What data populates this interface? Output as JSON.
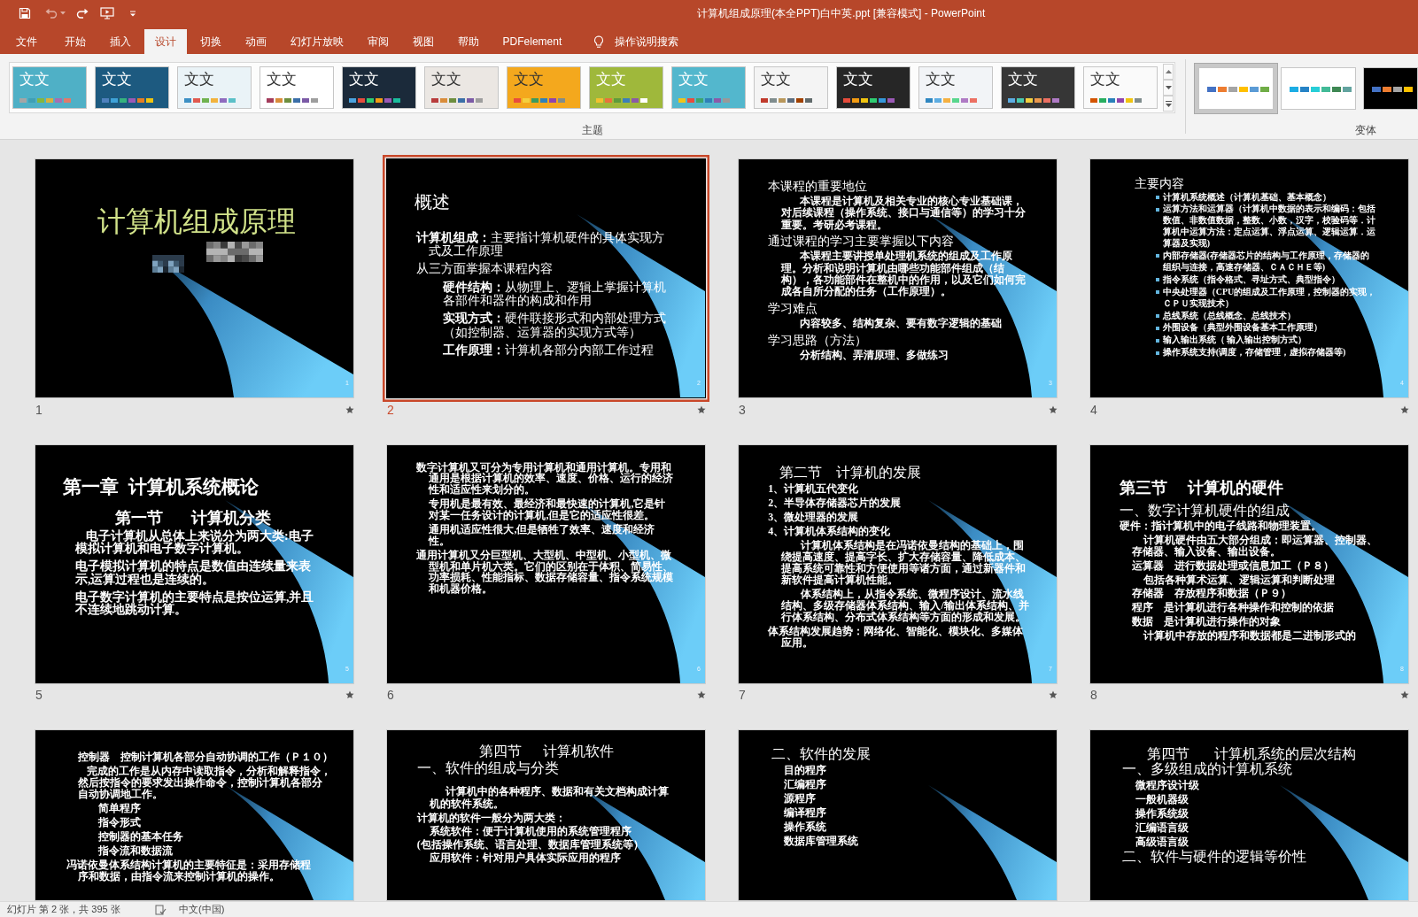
{
  "window": {
    "title": "计算机组成原理(本全PPT)白中英.ppt [兼容模式] - PowerPoint"
  },
  "quick_access": {
    "undo": {
      "disabled": true
    }
  },
  "ribbon_tabs": [
    {
      "label": "文件",
      "selected": false
    },
    {
      "label": "开始",
      "selected": false
    },
    {
      "label": "插入",
      "selected": false
    },
    {
      "label": "设计",
      "selected": true
    },
    {
      "label": "切换",
      "selected": false
    },
    {
      "label": "动画",
      "selected": false
    },
    {
      "label": "幻灯片放映",
      "selected": false
    },
    {
      "label": "审阅",
      "selected": false
    },
    {
      "label": "视图",
      "selected": false
    },
    {
      "label": "帮助",
      "selected": false
    },
    {
      "label": "PDFelement",
      "selected": false
    }
  ],
  "search": {
    "placeholder": "操作说明搜索"
  },
  "themes": {
    "label": "主题",
    "items": [
      {
        "sample": "文文",
        "color": "#4fb0c6",
        "swatches": [
          {
            "color": "#a5a5a5"
          },
          {
            "color": "#3f9fb5"
          },
          {
            "color": "#85b73e"
          },
          {
            "color": "#d9b13b"
          },
          {
            "color": "#a56fb3"
          },
          {
            "color": "#e07b6a"
          }
        ]
      },
      {
        "sample": "文文",
        "color": "#1d5a80",
        "swatches": [
          {
            "color": "#4f81bd"
          },
          {
            "color": "#3fa2d8"
          },
          {
            "color": "#36b37e"
          },
          {
            "color": "#9b59b6"
          },
          {
            "color": "#e67e22"
          },
          {
            "color": "#f1c40f"
          }
        ]
      },
      {
        "sample": "文文",
        "color": "#eaf3f7",
        "swatches": [
          {
            "color": "#3b8fc4"
          },
          {
            "color": "#e05a4f"
          },
          {
            "color": "#6fb24f"
          },
          {
            "color": "#f2b33d"
          },
          {
            "color": "#8e6bbf"
          },
          {
            "color": "#5bc0c8"
          }
        ]
      },
      {
        "sample": "文文",
        "color": "#ffffff",
        "swatches": [
          {
            "color": "#a33b5b"
          },
          {
            "color": "#d98c3a"
          },
          {
            "color": "#6d8e3e"
          },
          {
            "color": "#3b6fa8"
          },
          {
            "color": "#7b5aa6"
          },
          {
            "color": "#9e9e9e"
          }
        ]
      },
      {
        "sample": "文文",
        "color": "#1b2a3a",
        "swatches": [
          {
            "color": "#4aa3df"
          },
          {
            "color": "#e74c3c"
          },
          {
            "color": "#2ecc71"
          },
          {
            "color": "#f39c12"
          },
          {
            "color": "#9b59b6"
          },
          {
            "color": "#1abc9c"
          }
        ]
      },
      {
        "sample": "文文",
        "color": "#ebe7e3",
        "swatches": [
          {
            "color": "#b83b3b"
          },
          {
            "color": "#d98c3a"
          },
          {
            "color": "#6d8e3e"
          },
          {
            "color": "#3b6fa8"
          },
          {
            "color": "#7b5aa6"
          },
          {
            "color": "#9e9e9e"
          }
        ]
      },
      {
        "sample": "文文",
        "color": "#f4a81d",
        "swatches": [
          {
            "color": "#e84c3d"
          },
          {
            "color": "#f4d03f"
          },
          {
            "color": "#3c9a5f"
          },
          {
            "color": "#2f80b8"
          },
          {
            "color": "#8e44ad"
          },
          {
            "color": "#7f8c8d"
          }
        ]
      },
      {
        "sample": "文文",
        "color": "#9fb83b",
        "swatches": [
          {
            "color": "#f2c12e"
          },
          {
            "color": "#e8713c"
          },
          {
            "color": "#5d9b3c"
          },
          {
            "color": "#3c7fb8"
          },
          {
            "color": "#8a5aa6"
          },
          {
            "color": "#ffffff"
          }
        ]
      },
      {
        "sample": "文文",
        "color": "#53b7cd",
        "swatches": [
          {
            "color": "#f0c419"
          },
          {
            "color": "#e94b3c"
          },
          {
            "color": "#3ca56b"
          },
          {
            "color": "#2f7fb8"
          },
          {
            "color": "#8b5aa8"
          },
          {
            "color": "#999999"
          }
        ]
      },
      {
        "sample": "文文",
        "color": "#f4f4f4",
        "swatches": [
          {
            "color": "#c0392b"
          },
          {
            "color": "#7f8c8d"
          },
          {
            "color": "#b9975b"
          },
          {
            "color": "#5d6d7e"
          },
          {
            "color": "#a04000"
          },
          {
            "color": "#616a6b"
          }
        ]
      },
      {
        "sample": "文文",
        "color": "#262626",
        "swatches": [
          {
            "color": "#e74c3c"
          },
          {
            "color": "#f39c12"
          },
          {
            "color": "#f1c40f"
          },
          {
            "color": "#2ecc71"
          },
          {
            "color": "#3498db"
          },
          {
            "color": "#9b59b6"
          }
        ]
      },
      {
        "sample": "文文",
        "color": "#f2f4f7",
        "swatches": [
          {
            "color": "#2e86c1"
          },
          {
            "color": "#5dade2"
          },
          {
            "color": "#f5b041"
          },
          {
            "color": "#58d68d"
          },
          {
            "color": "#af7ac5"
          },
          {
            "color": "#ec7063"
          }
        ]
      },
      {
        "sample": "文文",
        "color": "#363636",
        "swatches": [
          {
            "color": "#5dade2"
          },
          {
            "color": "#48c9b0"
          },
          {
            "color": "#f4d03f"
          },
          {
            "color": "#eb984e"
          },
          {
            "color": "#ec7063"
          },
          {
            "color": "#af7ac5"
          }
        ]
      },
      {
        "sample": "文文",
        "color": "#fafafa",
        "swatches": [
          {
            "color": "#d35400"
          },
          {
            "color": "#27ae60"
          },
          {
            "color": "#2980b9"
          },
          {
            "color": "#8e44ad"
          },
          {
            "color": "#f1c40f"
          },
          {
            "color": "#7f8c8d"
          }
        ]
      }
    ]
  },
  "variants": {
    "label": "变体",
    "items": [
      {
        "selected": true,
        "color": "#ffffff",
        "swatches": [
          {
            "color": "#4472c4"
          },
          {
            "color": "#ed7d31"
          },
          {
            "color": "#a5a5a5"
          },
          {
            "color": "#ffc000"
          },
          {
            "color": "#5b9bd5"
          },
          {
            "color": "#70ad47"
          }
        ]
      },
      {
        "selected": false,
        "color": "#ffffff",
        "swatches": [
          {
            "color": "#1cade4"
          },
          {
            "color": "#2683c6"
          },
          {
            "color": "#27ced7"
          },
          {
            "color": "#42ba97"
          },
          {
            "color": "#3e8853"
          },
          {
            "color": "#62a39f"
          }
        ]
      },
      {
        "selected": false,
        "color": "#000000",
        "swatches": [
          {
            "color": "#4472c4"
          },
          {
            "color": "#ed7d31"
          },
          {
            "color": "#a5a5a5"
          },
          {
            "color": "#ffc000"
          }
        ]
      }
    ]
  },
  "slides": [
    {
      "number": "1",
      "selected": false,
      "kind": "title",
      "page_number": "1",
      "paragraphs": [
        {
          "kind": "title",
          "text": "计算机组成原理"
        }
      ]
    },
    {
      "number": "2",
      "selected": true,
      "kind": "content",
      "page_number": "2",
      "paragraphs": [
        {
          "kind": "title",
          "text": "概述"
        },
        {
          "kind": "item",
          "text": "**计算机组成：**主要指计算机硬件的具体实现方式及工作原理"
        },
        {
          "kind": "item",
          "text": "从三方面掌握本课程内容",
          "children": [
            {
              "kind": "line",
              "text": "**硬件结构：**从物理上、逻辑上掌握计算机各部件和器件的构成和作用"
            },
            {
              "kind": "line",
              "text": "**实现方式：**硬件联接形式和内部处理方式（如控制器、运算器的实现方式等）"
            },
            {
              "kind": "line",
              "text": "**工作原理：**计算机各部分内部工作过程"
            }
          ]
        }
      ]
    },
    {
      "number": "3",
      "selected": false,
      "kind": "content",
      "page_number": "3",
      "paragraphs": [
        {
          "kind": "heading",
          "text": "本课程的重要地位",
          "children": [
            {
              "kind": "para",
              "text": "本课程是计算机及相关专业的核心专业基础课，对后续课程（操作系统、接口与通信等）的学习十分重要。考研必考课程。"
            }
          ]
        },
        {
          "kind": "heading",
          "text": "通过课程的学习主要掌握以下内容",
          "children": [
            {
              "kind": "para",
              "text": "本课程主要讲授单处理机系统的组成及工作原理。分析和说明计算机由哪些功能部件组成（结构），各功能部件在整机中的作用，以及它们如何完成各自所分配的任务（工作原理）。"
            }
          ]
        },
        {
          "kind": "heading",
          "text": "学习难点",
          "children": [
            {
              "kind": "para",
              "text": "内容较多、结构复杂、要有数字逻辑的基础"
            }
          ]
        },
        {
          "kind": "heading",
          "text": "学习思路（方法）",
          "children": [
            {
              "kind": "para",
              "text": "分析结构、弄清原理、多做练习"
            }
          ]
        }
      ]
    },
    {
      "number": "4",
      "selected": false,
      "kind": "content",
      "page_number": "4",
      "paragraphs": [
        {
          "kind": "heading",
          "text": "主要内容",
          "children": [
            {
              "kind": "bullet",
              "text": "计算机系统概述（计算机基础、基本概念）"
            },
            {
              "kind": "bullet",
              "text": "运算方法和运算器（计算机中数据的表示和编码：包括数值、非数值数据，整数、小数，汉字，校验码等．计算机中运算方法：定点运算、浮点运算、逻辑运算．运算器及实现)"
            },
            {
              "kind": "bullet",
              "text": "内部存储器(存储器芯片的结构与工作原理，存储器的组织与连接，高速存储器、ＣＡＣＨＥ等)"
            },
            {
              "kind": "bullet",
              "text": "指令系统（指令格式、寻址方式、典型指令）"
            },
            {
              "kind": "bullet",
              "text": "中央处理器（CPU的组成及工作原理，控制器的实现，ＣＰＵ实现技术）"
            },
            {
              "kind": "bullet",
              "text": "总线系统（总线概念、总线技术）"
            },
            {
              "kind": "bullet",
              "text": "外围设备（典型外围设备基本工作原理）"
            },
            {
              "kind": "bullet",
              "text": "输入输出系统（ 输入输出控制方式）"
            },
            {
              "kind": "bullet",
              "text": "操作系统支持(调度，存储管理，虚拟存储器等)"
            }
          ]
        }
      ]
    },
    {
      "number": "5",
      "selected": false,
      "kind": "content",
      "page_number": "5",
      "paragraphs": [
        {
          "kind": "title",
          "text": "第一章  计算机系统概论"
        },
        {
          "kind": "center",
          "text": "第一节    计算机分类",
          "children": [
            {
              "kind": "para",
              "text": "电子计算机从总体上来说分为两大类:电子模拟计算机和电子数字计算机。"
            },
            {
              "kind": "line",
              "text": "电子模拟计算机的特点是数值由连续量来表示,运算过程也是连续的。"
            },
            {
              "kind": "line",
              "text": "电子数字计算机的主要特点是按位运算,并且不连续地跳动计算。"
            }
          ]
        }
      ]
    },
    {
      "number": "6",
      "selected": false,
      "kind": "content",
      "page_number": "6",
      "paragraphs": [
        {
          "kind": "item",
          "text": "数字计算机又可分为专用计算机和通用计算机。专用和通用是根据计算机的效率、速度、价格、运行的经济性和适应性来划分的。",
          "children": [
            {
              "kind": "line",
              "text": "专用机是最有效、最经济和最快速的计算机,它是针对某一任务设计的计算机,但是它的适应性很差。"
            },
            {
              "kind": "line",
              "text": "通用机适应性很大,但是牺牲了效率、速度和经济性。"
            }
          ]
        },
        {
          "kind": "item",
          "text": "通用计算机又分巨型机、大型机、中型机、小型机、微型机和单片机六类。它们的区别在于体积、简易性、功率损耗、性能指标、数据存储容量、指令系统规模和机器价格。"
        }
      ]
    },
    {
      "number": "7",
      "selected": false,
      "kind": "content",
      "page_number": "7",
      "paragraphs": [
        {
          "kind": "title",
          "text": "第二节    计算机的发展"
        },
        {
          "kind": "line",
          "text": "1、计算机五代变化"
        },
        {
          "kind": "line",
          "text": "2、半导体存储器芯片的发展"
        },
        {
          "kind": "line",
          "text": "3、微处理器的发展"
        },
        {
          "kind": "line",
          "text": "4、计算机体系结构的变化",
          "children": [
            {
              "kind": "para",
              "text": "计算机体系结构是在冯诺依曼结构的基础上，围绕提高速度、提高字长、扩大存储容量、降低成本、提高系统可靠性和方便使用等诸方面，通过新器件和新软件提高计算机性能。"
            },
            {
              "kind": "para",
              "text": "体系结构上，从指令系统、微程序设计、流水线结构、多级存储器体系结构、输入/输出体系结构、并行体系结构、分布式体系结构等方面的形成和发展。"
            }
          ]
        },
        {
          "kind": "item",
          "text": "体系结构发展趋势：网络化、智能化、模块化、多媒体应用。"
        }
      ]
    },
    {
      "number": "8",
      "selected": false,
      "kind": "content",
      "page_number": "8",
      "paragraphs": [
        {
          "kind": "title",
          "text": "第三节    计算机的硬件"
        },
        {
          "kind": "heading",
          "text": "一、数字计算机硬件的组成"
        },
        {
          "kind": "line",
          "text": "硬件：指计算机中的电子线路和物理装置。",
          "children": [
            {
              "kind": "para",
              "text": "计算机硬件由五大部分组成：即运算器、控制器、存储器、输入设备、输出设备。"
            },
            {
              "kind": "line",
              "text": "运算器    进行数据处理或信息加工（Ｐ８）"
            },
            {
              "kind": "para",
              "text": "包括各种算术运算、逻辑运算和判断处理"
            },
            {
              "kind": "line",
              "text": "存储器    存放程序和数据（Ｐ９）"
            },
            {
              "kind": "line",
              "text": "程序    是计算机进行各种操作和控制的依据"
            },
            {
              "kind": "line",
              "text": "数据    是计算机进行操作的对象"
            },
            {
              "kind": "para",
              "text": "计算机中存放的程序和数据都是二进制形式的"
            }
          ]
        }
      ]
    },
    {
      "selected": false,
      "kind": "content",
      "paragraphs": [
        {
          "kind": "line",
          "text": "控制器    控制计算机各部分自动协调的工作（Ｐ１０）"
        },
        {
          "kind": "para",
          "text": "完成的工作是从内存中读取指令，分析和解释指令，然后按指令的要求发出操作命令，控制计算机各部分自动协调地工作。",
          "children": [
            {
              "kind": "line",
              "text": "简单程序"
            },
            {
              "kind": "line",
              "text": "指令形式"
            },
            {
              "kind": "line",
              "text": "控制器的基本任务"
            },
            {
              "kind": "line",
              "text": "指令流和数据流"
            }
          ]
        },
        {
          "kind": "outdent",
          "text": "冯诺依曼体系结构计算机的主要特征是：采用存储程序和数据，由指令流来控制计算机的操作。"
        }
      ]
    },
    {
      "selected": false,
      "kind": "content",
      "paragraphs": [
        {
          "kind": "center",
          "text": "第四节    计算机软件"
        },
        {
          "kind": "heading",
          "text": "一、软件的组成与分类",
          "children": [
            {
              "kind": "para",
              "text": "计算机中的各种程序、数据和有关文档构成计算机的软件系统。"
            }
          ]
        },
        {
          "kind": "line",
          "text": "计算机的软件一般分为两大类：",
          "children": [
            {
              "kind": "line",
              "text": "系统软件：便于计算机使用的系统管理程序"
            },
            {
              "kind": "outdent",
              "text": "(包括操作系统、语言处理、数据库管理系统等）"
            },
            {
              "kind": "line",
              "text": "应用软件：针对用户具体实际应用的程序"
            }
          ]
        }
      ]
    },
    {
      "selected": false,
      "kind": "content",
      "paragraphs": [
        {
          "kind": "heading",
          "text": "二、软件的发展",
          "children": [
            {
              "kind": "line",
              "text": "目的程序"
            },
            {
              "kind": "line",
              "text": "汇编程序"
            },
            {
              "kind": "line",
              "text": "源程序"
            },
            {
              "kind": "line",
              "text": "编译程序"
            },
            {
              "kind": "line",
              "text": "操作系统"
            },
            {
              "kind": "line",
              "text": "数据库管理系统"
            }
          ]
        }
      ]
    },
    {
      "selected": false,
      "kind": "content",
      "paragraphs": [
        {
          "kind": "center",
          "text": "第四节    计算机系统的层次结构"
        },
        {
          "kind": "heading",
          "text": "一、多级组成的计算机系统",
          "children": [
            {
              "kind": "line",
              "text": "微程序设计级"
            },
            {
              "kind": "line",
              "text": "一般机器级"
            },
            {
              "kind": "line",
              "text": "操作系统级"
            },
            {
              "kind": "line",
              "text": "汇编语言级"
            },
            {
              "kind": "line",
              "text": "高级语言级"
            }
          ]
        },
        {
          "kind": "heading",
          "text": "二、软件与硬件的逻辑等价性"
        }
      ]
    }
  ],
  "status_bar": {
    "slide_info": "幻灯片 第 2 张，共 395 张",
    "language": "中文(中国)"
  }
}
